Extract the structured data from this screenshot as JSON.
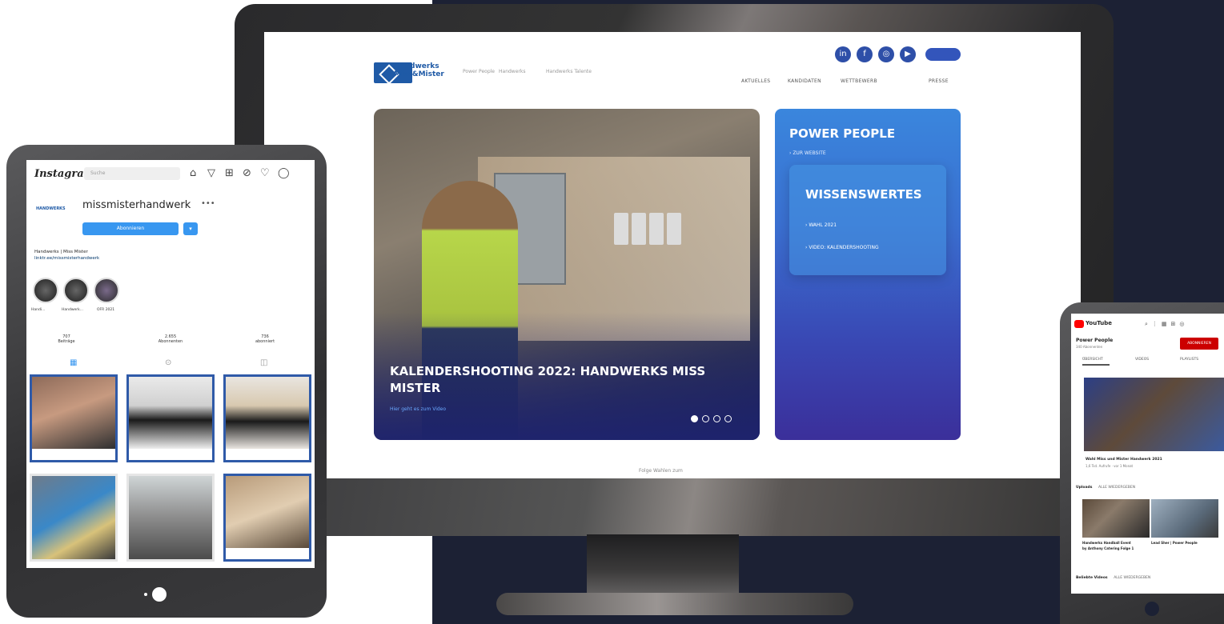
{
  "desktop": {
    "logo_line1": "Handwerks",
    "logo_line2": "Miss&Mister",
    "partners": [
      "Power People",
      "Handwerks",
      "Handwerks Talente"
    ],
    "social_icons": [
      "linkedin-icon",
      "facebook-icon",
      "instagram-icon",
      "youtube-icon"
    ],
    "nav": [
      "AKTUELLES",
      "KANDIDATEN",
      "WETTBEWERB",
      "PRESSE"
    ],
    "hero": {
      "title": "KALENDERSHOOTING 2022: HANDWERKS MISS MISTER",
      "link": "Hier geht es zum Video",
      "slides": 4,
      "active_slide": 1
    },
    "side": {
      "title": "POWER PEOPLE",
      "link": "ZUR WEBSITE",
      "box_title": "WISSENSWERTES",
      "box_links": [
        "WAHL 2021",
        "VIDEO: KALENDERSHOOTING"
      ]
    },
    "footer_note": "Folge Wahlen zum"
  },
  "instagram": {
    "logo": "Instagram",
    "search_placeholder": "Suche",
    "username": "missmisterhandwerk",
    "more": "•••",
    "follow_label": "Abonnieren",
    "avatar_text": "HANDWERKS",
    "bio_name": "Handwerks | Miss Mister",
    "bio_link": "linktr.ee/missmisterhandwerk",
    "highlights": [
      "Handi...",
      "Handwerk...",
      "OFR 2021"
    ],
    "stats": [
      {
        "value": "707",
        "label": "Beiträge"
      },
      {
        "value": "2.655",
        "label": "Abonnenten"
      },
      {
        "value": "736",
        "label": "abonniert"
      }
    ]
  },
  "youtube": {
    "logo": "YouTube",
    "channel": "Power People",
    "subscribers": "340 Abonnenten",
    "subscribe_label": "ABONNIEREN",
    "tabs": [
      "ÜBERSICHT",
      "VIDEOS",
      "PLAYLISTS"
    ],
    "featured_title": "Wahl Miss und Mister Handwerk 2021",
    "featured_meta": "1,6 Tsd. Aufrufe · vor 1 Monat",
    "section_uploads": "Uploads",
    "section_uploads_action": "ALLE WIEDERGEBEN",
    "video1_title": "Handwerks Handball Event",
    "video1_title2": "by Anthony Catering Folge 1",
    "video2_title": "Lead Sher | Power People",
    "section_more": "Beliebte Videos",
    "section_more_action": "ALLE WIEDERGEBEN"
  }
}
